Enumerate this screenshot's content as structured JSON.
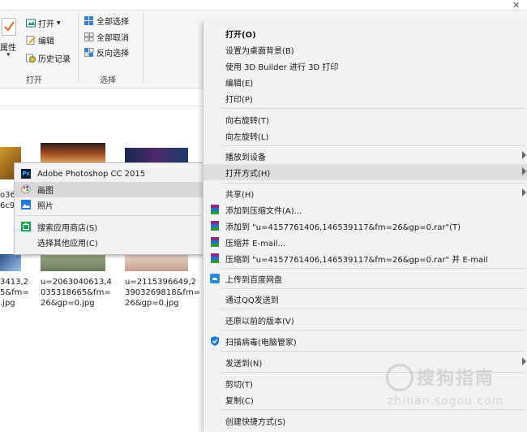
{
  "ribbon": {
    "properties_label": "属性",
    "open_label": "打开",
    "edit_label": "编辑",
    "history_label": "历史记录",
    "select_all_label": "全部选择",
    "select_none_label": "全部取消",
    "invert_select_label": "反向选择",
    "group_open": "打开",
    "group_select": "选择"
  },
  "files": [
    {
      "name": "3413,2\n5&fm=\n.jpg"
    },
    {
      "name": "u=2063040613,4\n035318665&fm=\n26&gp=0.jpg"
    },
    {
      "name": "u=2115396649,2\n3903269818&fm=\n26&gp=0.jpg"
    }
  ],
  "fragments": {
    "a": "o36",
    "b": "6c9"
  },
  "submenu": {
    "items": [
      {
        "label": "Adobe Photoshop CC 2015",
        "icon": "photoshop-icon"
      },
      {
        "label": "画图",
        "icon": "paint-icon"
      },
      {
        "label": "照片",
        "icon": "photos-icon"
      },
      {
        "label": "搜索应用商店(S)",
        "icon": "store-icon"
      },
      {
        "label": "选择其他应用(C)",
        "icon": ""
      }
    ]
  },
  "context_menu": {
    "items": [
      {
        "label": "打开(O)"
      },
      {
        "label": "设置为桌面背景(B)"
      },
      {
        "label": "使用 3D Builder 进行 3D 打印"
      },
      {
        "label": "编辑(E)"
      },
      {
        "label": "打印(P)"
      },
      {
        "label": "向右旋转(T)"
      },
      {
        "label": "向左旋转(L)"
      },
      {
        "label": "播放到设备"
      },
      {
        "label": "打开方式(H)"
      },
      {
        "label": "共享(H)"
      },
      {
        "label": "添加到压缩文件(A)..."
      },
      {
        "label": "添加到 \"u=4157761406,146539117&fm=26&gp=0.rar\"(T)"
      },
      {
        "label": "压缩并 E-mail..."
      },
      {
        "label": "压缩到 \"u=4157761406,146539117&fm=26&gp=0.rar\" 并 E-mail"
      },
      {
        "label": "上传到百度网盘"
      },
      {
        "label": "通过QQ发送到"
      },
      {
        "label": "还原以前的版本(V)"
      },
      {
        "label": "扫描病毒(电脑管家)"
      },
      {
        "label": "发送到(N)"
      },
      {
        "label": "剪切(T)"
      },
      {
        "label": "复制(C)"
      },
      {
        "label": "创建快捷方式(S)"
      }
    ]
  },
  "watermark": {
    "text": "搜狗指南",
    "url": "zhinan.sogou.com"
  },
  "colors": {
    "highlight": "#dedede",
    "menu_bg": "#f2f2f2",
    "accent_blue": "#1e88e5"
  }
}
